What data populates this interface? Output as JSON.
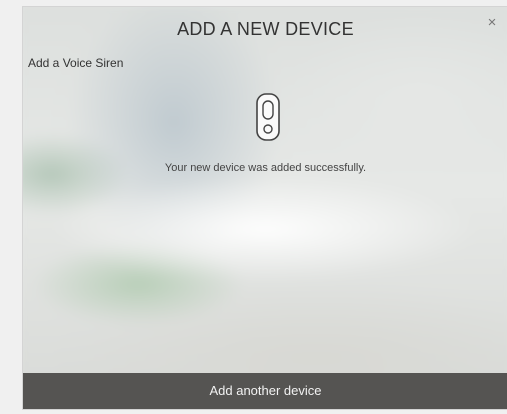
{
  "dialog": {
    "title": "ADD A NEW DEVICE",
    "close_symbol": "×",
    "subtitle": "Add a Voice Siren",
    "device_icon": "voice-siren-icon",
    "message": "Your new device was added successfully.",
    "button_label": "Add another device"
  }
}
